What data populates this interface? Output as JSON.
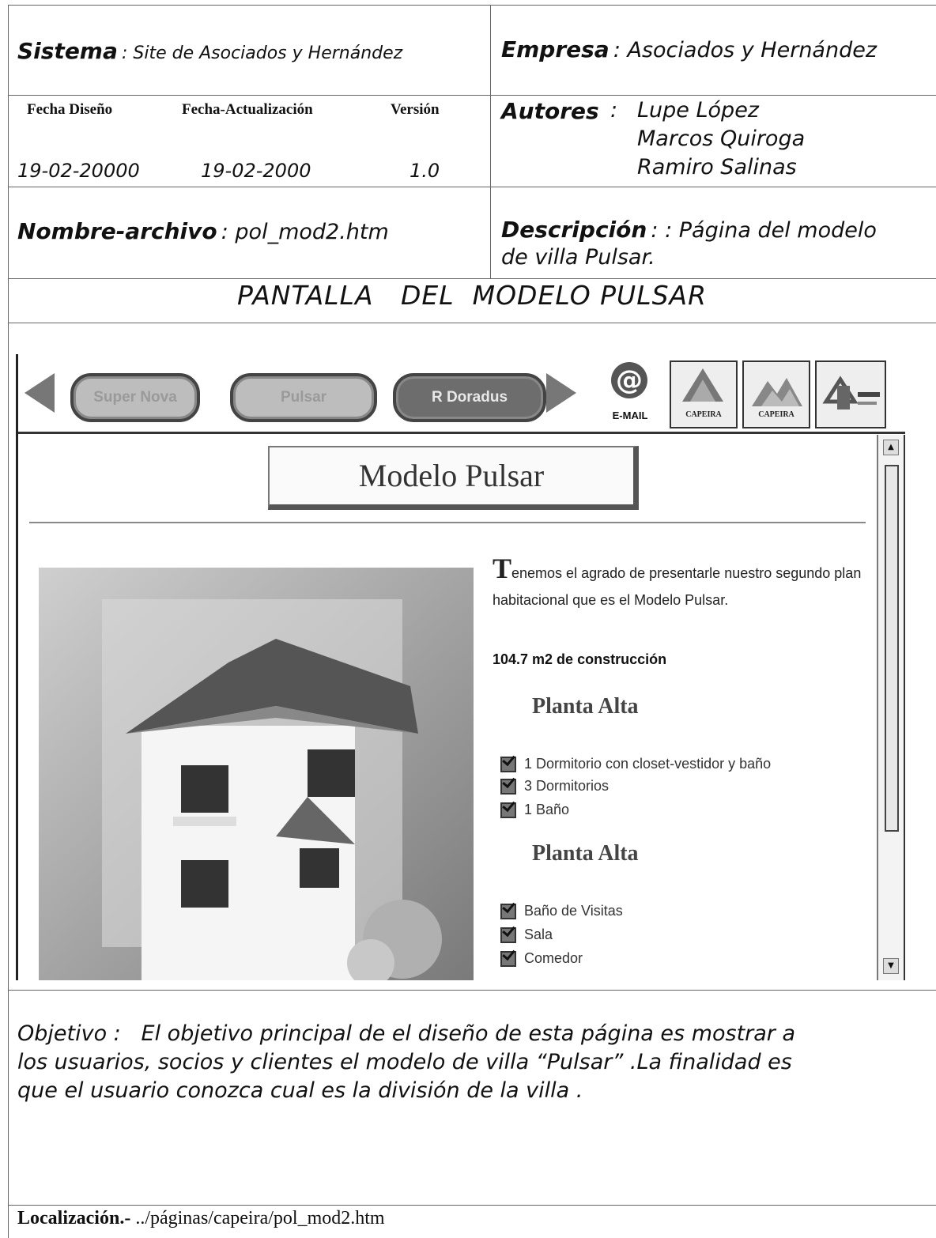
{
  "header": {
    "sistema_label": "Sistema",
    "sistema_value": ": Site de Asociados y Hernández",
    "empresa_label": "Empresa",
    "empresa_value": ": Asociados y Hernández",
    "fecha_diseno_label": "Fecha Diseño",
    "fecha_actualizacion_label": "Fecha-Actualización",
    "version_label": "Versión",
    "fecha_diseno_value": "19-02-20000",
    "fecha_actualizacion_value": "19-02-2000",
    "version_value": "1.0",
    "autores_label": "Autores",
    "autores_sep": ":",
    "autores": [
      "Lupe López",
      "Marcos Quiroga",
      "Ramiro Salinas"
    ],
    "archivo_label": "Nombre-archivo",
    "archivo_value": ": pol_mod2.htm",
    "descripcion_label": "Descripción",
    "descripcion_value_line1": ": : Página  del modelo",
    "descripcion_value_line2": "de villa  Pulsar.",
    "pantalla_title": "PANTALLA   DEL  MODELO PULSAR"
  },
  "screenshot": {
    "nav_buttons": [
      "Super Nova",
      "Pulsar",
      "R Doradus"
    ],
    "email_label": "E-MAIL",
    "logo_captions": [
      "CAPEIRA",
      "CAPEIRA",
      ""
    ],
    "page_title": "Modelo Pulsar",
    "intro_first_letter": "T",
    "intro_rest": "enemos el agrado de presentarle nuestro segundo plan habitacional que es el Modelo Pulsar.",
    "area": "104.7 m2 de construcción",
    "section1_title": "Planta Alta",
    "section1_items": [
      "1 Dormitorio con closet-vestidor y baño",
      "3 Dormitorios",
      "1 Baño"
    ],
    "section2_title": "Planta Alta",
    "section2_items": [
      "Baño de Visitas",
      "Sala",
      "Comedor"
    ],
    "colors": {
      "nav_button": "#bdbdbd",
      "nav_button_active": "#6d6d6d",
      "arrow": "#777777"
    }
  },
  "footer": {
    "objetivo_label": "Objetivo :",
    "objetivo_line1": "El objetivo principal de el diseño de esta página es mostrar  a",
    "objetivo_line2": "los usuarios, socios y clientes  el  modelo de villa  “Pulsar” .La finalidad es",
    "objetivo_line3": "que el usuario conozca  cual es la división de la villa .",
    "localizacion_label": "Localización.-",
    "localizacion_value": "../páginas/capeira/pol_mod2.htm"
  }
}
